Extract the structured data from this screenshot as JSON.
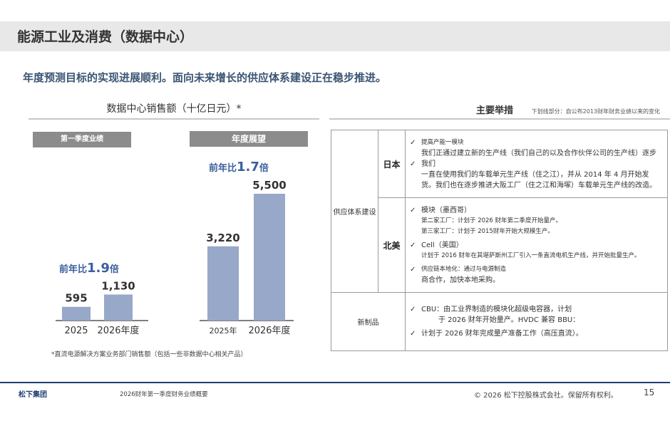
{
  "title": "能源工业及消费（数据中心）",
  "headline": "年度预测目标的实现进展顺利。面向未来增长的供应体系建设正在稳步推进。",
  "left_section": {
    "title": "数据中心销售额（十亿日元）*",
    "header_q1": "第一季度业绩",
    "header_year": "年度展望",
    "footnote": "*直流电源解决方案业务部门销售额（包括一些非数据中心相关产品）"
  },
  "chart_data": [
    {
      "type": "bar",
      "title": "第一季度业绩",
      "categories": [
        "2025",
        "2026年度"
      ],
      "values": [
        595,
        1130
      ],
      "value_labels": [
        "595",
        "1,130"
      ],
      "annotation": {
        "prefix": "前年比",
        "value": "1.9",
        "suffix": "倍"
      },
      "color": "#97a8c9",
      "ylim": [
        0,
        5500
      ]
    },
    {
      "type": "bar",
      "title": "年度展望",
      "categories": [
        "2025年",
        "2026年度"
      ],
      "values": [
        3220,
        5500
      ],
      "value_labels": [
        "3,220",
        "5,500"
      ],
      "annotation": {
        "prefix": "前年比",
        "value": "1.7",
        "suffix": "倍"
      },
      "color": "#97a8c9",
      "ylim": [
        0,
        5500
      ]
    }
  ],
  "right_section": {
    "title": "主要举措",
    "note": "下划线部分：自公布2013财年财务业绩以来的变化"
  },
  "table": {
    "category_build": "供应体系建设",
    "category_new": "新制品",
    "region_japan": "日本",
    "region_na": "北美",
    "japan": {
      "item1_title": "提高产能一模块",
      "item1_text": "我们正通过建立新的生产线（我们自己的以及合作伙伴公司的生产线）逐步",
      "item2_title": "我们",
      "item2_text": "一直在使用我们的车载单元生产线（住之江），并从 2014 年 4 月开始发货。我们也在逐步推进大阪工厂（住之江和海塚）车载单元生产线的改造。"
    },
    "na": {
      "item1_title": "模块（墨西哥）",
      "item1_line1": "第二家工厂：计划于 2026 财年第二季度开始量产。",
      "item1_line2": "第三家工厂：计划于 2015财年开始大规模生产。",
      "item2_title": "Cell（美国）",
      "item2_text": "计划于 2016 财年在其堪萨斯州工厂引入一条直流电机生产线，并开始批量生产。",
      "item3_line1": "供应链本地化：通过与电源制造",
      "item3_line2": "商合作，加快本地采购。"
    },
    "new_products": {
      "item1_line1": "CBU：由工业界制造的模块化超级电容器，计划",
      "item1_line2": "于 2026 财年开始量产。HVDC 兼容 BBU：",
      "item2_text": "计划于 2026 财年完成量产准备工作（高压直流）。"
    }
  },
  "footer": {
    "company": "松下集团",
    "doc": "2026财年第一季度财务业绩概要",
    "copyright": "© 2026 松下控股株式会社。保留所有权利。",
    "page": "15"
  },
  "icons": {
    "check": "check-icon"
  }
}
